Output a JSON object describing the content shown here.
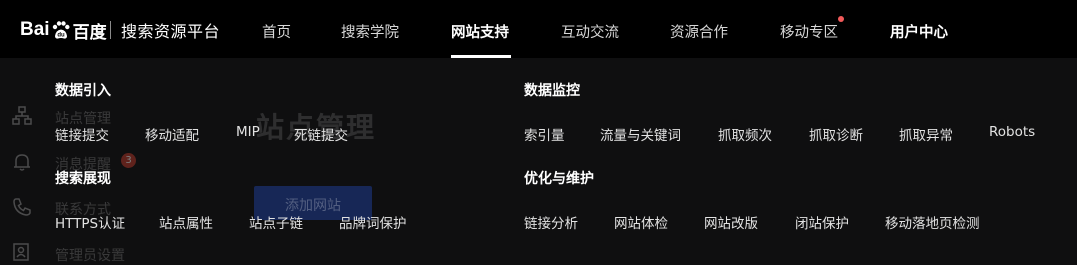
{
  "header": {
    "logo_text_left": "Bai",
    "logo_text_right": "百度",
    "platform_name": "搜索资源平台",
    "nav": [
      {
        "label": "首页"
      },
      {
        "label": "搜索学院"
      },
      {
        "label": "网站支持",
        "active": true
      },
      {
        "label": "互动交流"
      },
      {
        "label": "资源合作"
      },
      {
        "label": "移动专区",
        "has_notification": true
      },
      {
        "label": "用户中心"
      }
    ],
    "accent_color": "#ffffff",
    "notification_color": "#f25a5a"
  },
  "background_page": {
    "title": "站点管理",
    "sidebar": [
      {
        "label": "站点管理",
        "icon": "sitemap-icon"
      },
      {
        "label": "消息提醒",
        "icon": "bell-icon",
        "badge": "3"
      },
      {
        "label": "联系方式",
        "icon": "phone-icon"
      },
      {
        "label": "管理员设置",
        "icon": "user-settings-icon"
      }
    ],
    "button_label": "添加网站"
  },
  "dropdown": {
    "sections": [
      {
        "title": "数据引入",
        "links": [
          "链接提交",
          "移动适配",
          "MIP",
          "死链提交"
        ]
      },
      {
        "title": "数据监控",
        "links": [
          "索引量",
          "流量与关键词",
          "抓取频次",
          "抓取诊断",
          "抓取异常",
          "Robots"
        ]
      },
      {
        "title": "搜索展现",
        "links": [
          "HTTPS认证",
          "站点属性",
          "站点子链",
          "品牌词保护"
        ]
      },
      {
        "title": "优化与维护",
        "links": [
          "链接分析",
          "网站体检",
          "网站改版",
          "闭站保护",
          "移动落地页检测"
        ]
      }
    ]
  }
}
